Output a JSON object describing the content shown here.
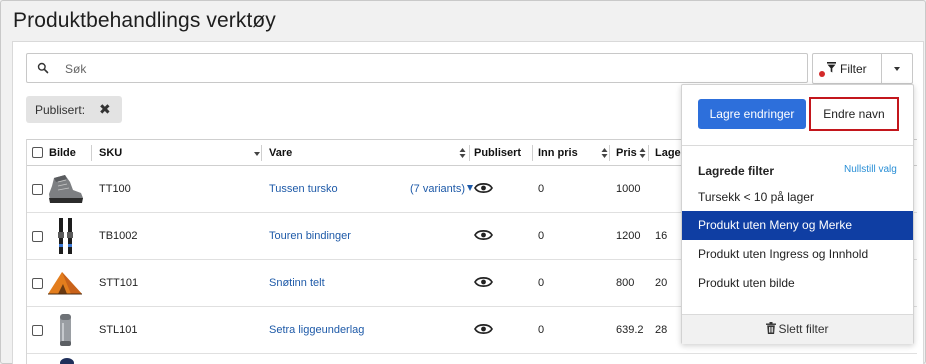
{
  "page": {
    "title": "Produktbehandlings verktøy"
  },
  "search": {
    "placeholder": "Søk",
    "value": ""
  },
  "filter": {
    "label": "Filter",
    "has_active": true
  },
  "active_filter_chip": {
    "label": "Publisert:",
    "close": "✖"
  },
  "table": {
    "columns": [
      "Bilde",
      "SKU",
      "Vare",
      "Publisert",
      "Inn pris",
      "Pris",
      "Lager"
    ],
    "rows": [
      {
        "sku": "TT100",
        "vare": "Tussen tursko",
        "variants": "(7 variants)",
        "inn_pris": "0",
        "pris": "1000",
        "lager": ""
      },
      {
        "sku": "TB1002",
        "vare": "Touren bindinger",
        "variants": "",
        "inn_pris": "0",
        "pris": "1200",
        "lager": "16"
      },
      {
        "sku": "STT101",
        "vare": "Snøtinn telt",
        "variants": "",
        "inn_pris": "0",
        "pris": "800",
        "lager": "20"
      },
      {
        "sku": "STL101",
        "vare": "Setra liggeunderlag",
        "variants": "",
        "inn_pris": "0",
        "pris": "639.2",
        "lager": "28"
      }
    ]
  },
  "filter_panel": {
    "save_label": "Lagre endringer",
    "rename_label": "Endre navn",
    "saved_title": "Lagrede filter",
    "reset_label": "Nullstill valg",
    "saved_filters": [
      {
        "label": "Tursekk < 10 på lager",
        "active": false
      },
      {
        "label": "Produkt uten Meny og Merke",
        "active": true
      },
      {
        "label": "Produkt uten Ingress og Innhold",
        "active": false
      },
      {
        "label": "Produkt uten bilde",
        "active": false
      }
    ],
    "delete_label": "Slett filter"
  },
  "colors": {
    "primary": "#2d6fdb",
    "active_item": "#0f3ea3",
    "highlight_border": "#c3161c",
    "link": "#1e5aa8",
    "status_dot": "#d42a2a"
  }
}
